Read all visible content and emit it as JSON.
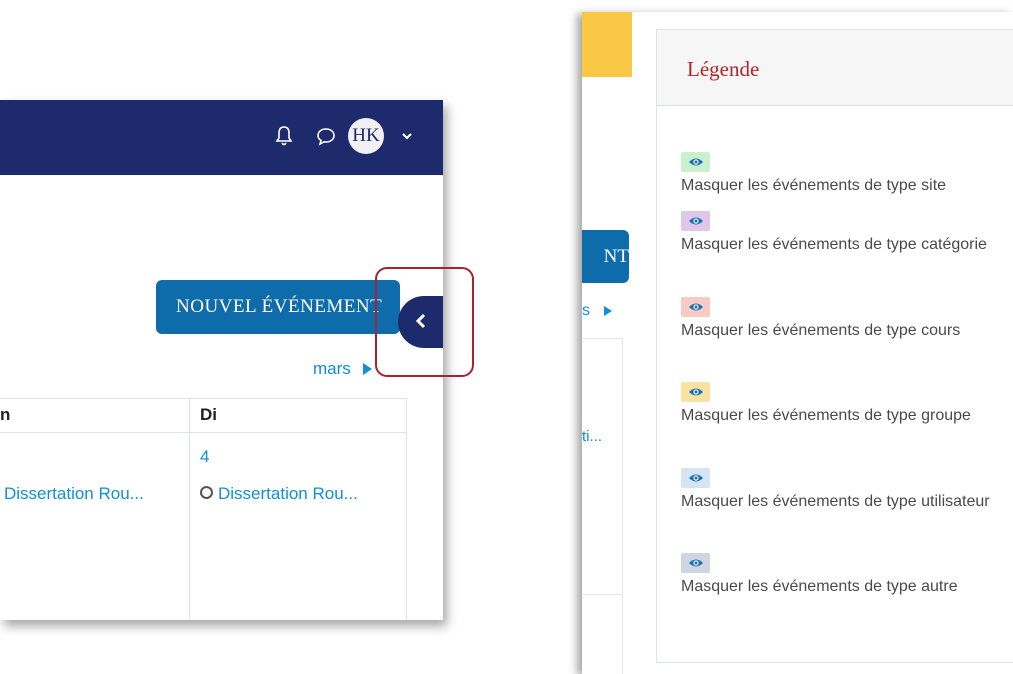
{
  "left": {
    "user_initials": "HK",
    "new_event_button": "NOUVEL ÉVÉNEMENT",
    "next_month_link": "mars",
    "columns": [
      {
        "head": "n"
      },
      {
        "head": "Di"
      }
    ],
    "day_number": "4",
    "event_partial": "Dissertation Rou...",
    "event_full": "Dissertation Rou...",
    "colors": {
      "navbar": "#1d2a6b",
      "button": "#0f6cab",
      "link": "#0f8fd8",
      "highlight": "#a7232d"
    }
  },
  "right": {
    "background_button_fragment": "NT",
    "background_link_fragment": "s",
    "background_event_fragment": "ti...",
    "legend_title": "Légende",
    "legend_items": [
      {
        "label": "Masquer les événements de type site",
        "color": "#c9f0cf"
      },
      {
        "label": "Masquer les événements de type catégorie",
        "color": "#dfc7ea"
      },
      {
        "label": "Masquer les événements de type cours",
        "color": "#f7cbc3"
      },
      {
        "label": "Masquer les événements de type groupe",
        "color": "#fbe2a2"
      },
      {
        "label": "Masquer les événements de type utilisateur",
        "color": "#d5e5f2"
      },
      {
        "label": "Masquer les événements de type autre",
        "color": "#cfd6e2"
      }
    ],
    "colors": {
      "title": "#b2242b",
      "accent_strip": "#f9c847"
    }
  }
}
